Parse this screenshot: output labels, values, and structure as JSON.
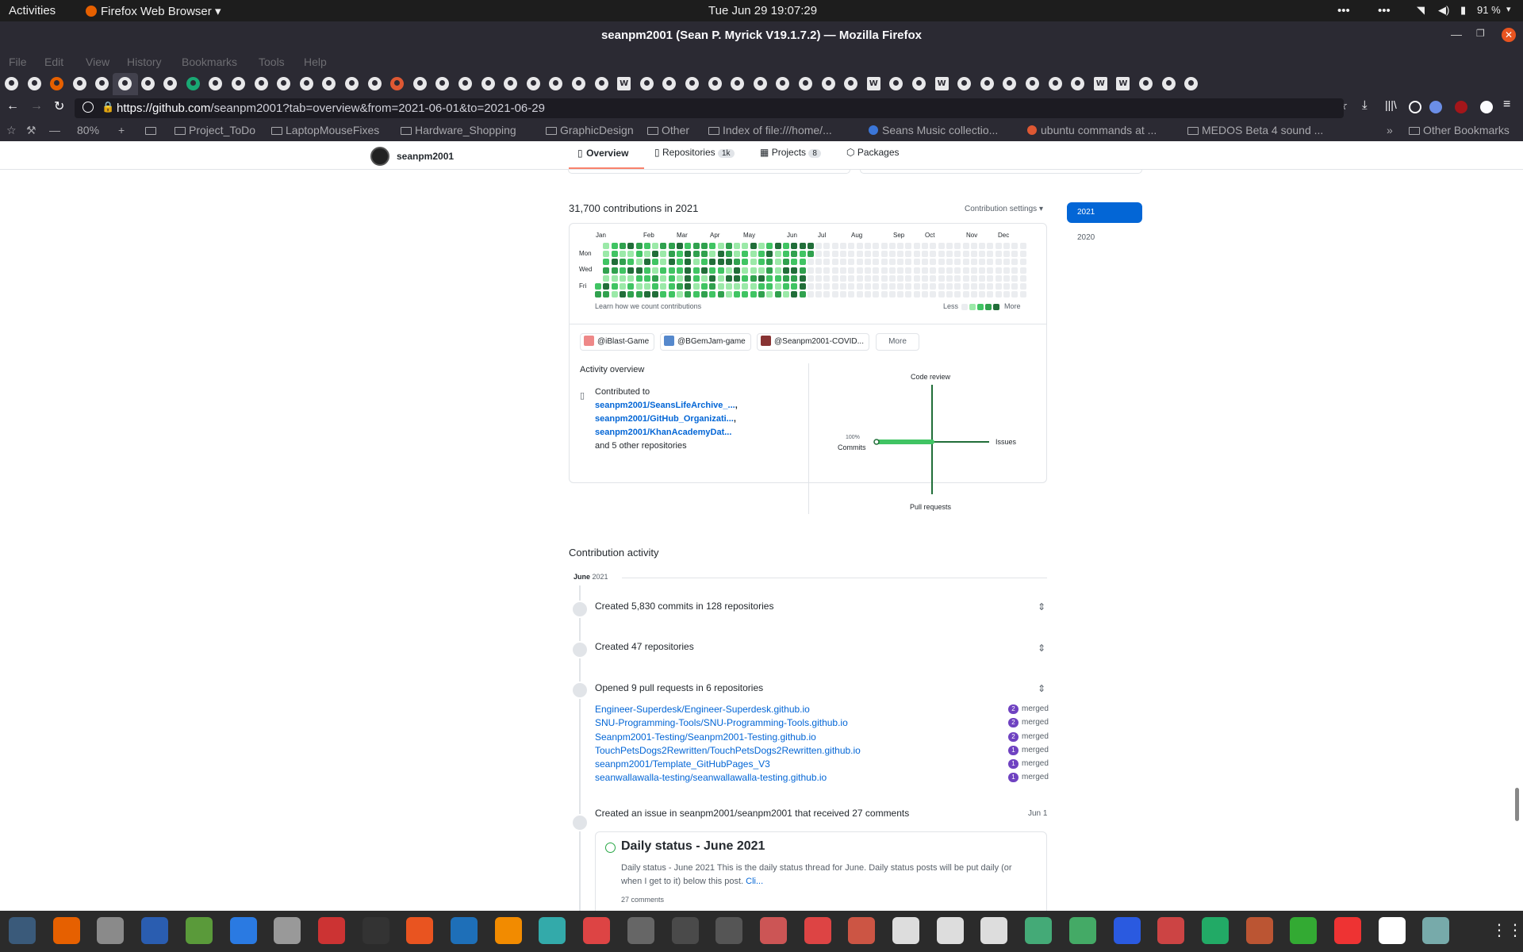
{
  "topbar": {
    "activities": "Activities",
    "app_name": "Firefox Web Browser",
    "clock": "Tue Jun 29  19:07:29",
    "battery": "91 %"
  },
  "window": {
    "title": "seanpm2001 (Sean P. Myrick V19.1.7.2) — Mozilla Firefox"
  },
  "menu": [
    "File",
    "Edit",
    "View",
    "History",
    "Bookmarks",
    "Tools",
    "Help"
  ],
  "navbar": {
    "url_host": "https://github.com",
    "url_path": "/seanpm2001?tab=overview&from=2021-06-01&to=2021-06-29"
  },
  "bookmarks": {
    "zoom": "80%",
    "items": [
      "Project_ToDo",
      "LaptopMouseFixes",
      "Hardware_Shopping",
      "GraphicDesign",
      "Other",
      "Index of file:///home/...",
      "Seans Music collectio...",
      "ubuntu commands at ...",
      "MEDOS Beta 4 sound ..."
    ],
    "other": "Other Bookmarks"
  },
  "profile": {
    "username": "seanpm2001",
    "tabs": [
      {
        "label": "Overview",
        "count": ""
      },
      {
        "label": "Repositories",
        "count": "1k"
      },
      {
        "label": "Projects",
        "count": "8"
      },
      {
        "label": "Packages",
        "count": ""
      }
    ]
  },
  "contrib": {
    "heading": "31,700 contributions in 2021",
    "settings": "Contribution settings",
    "months": [
      "Jan",
      "Feb",
      "Mar",
      "Apr",
      "May",
      "Jun",
      "Jul",
      "Aug",
      "Sep",
      "Oct",
      "Nov",
      "Dec"
    ],
    "days": [
      "Mon",
      "Wed",
      "Fri"
    ],
    "learn": "Learn how we count contributions",
    "less": "Less",
    "more": "More",
    "years": [
      "2021",
      "2020"
    ],
    "colors": {
      "empty": "#ebedf0",
      "l1": "#9be9a8",
      "l2": "#40c463",
      "l3": "#30a14e",
      "l4": "#216e39"
    }
  },
  "orgs": [
    "@iBlast-Game",
    "@BGemJam-game",
    "@Seanpm2001-COVID...",
    "More"
  ],
  "activity": {
    "title": "Activity overview",
    "contributed_to": "Contributed to",
    "repos": [
      "seanpm2001/SeansLifeArchive_...",
      "seanpm2001/GitHub_Organizati...",
      "seanpm2001/KhanAcademyDat..."
    ],
    "others": "and 5 other repositories",
    "axes": {
      "top": "Code review",
      "right": "Issues",
      "bottom": "Pull requests",
      "left_pct": "100%",
      "left": "Commits"
    }
  },
  "timeline": {
    "heading": "Contribution activity",
    "month": "June",
    "year": "2021",
    "commits": "Created 5,830 commits in 128 repositories",
    "repos_created": "Created 47 repositories",
    "prs": "Opened 9 pull requests in 6 repositories",
    "pr_list": [
      {
        "repo": "Engineer-Superdesk/Engineer-Superdesk.github.io",
        "count": "2",
        "state": "merged"
      },
      {
        "repo": "SNU-Programming-Tools/SNU-Programming-Tools.github.io",
        "count": "2",
        "state": "merged"
      },
      {
        "repo": "Seanpm2001-Testing/Seanpm2001-Testing.github.io",
        "count": "2",
        "state": "merged"
      },
      {
        "repo": "TouchPetsDogs2Rewritten/TouchPetsDogs2Rewritten.github.io",
        "count": "1",
        "state": "merged"
      },
      {
        "repo": "seanpm2001/Template_GitHubPages_V3",
        "count": "1",
        "state": "merged"
      },
      {
        "repo": "seanwallawalla-testing/seanwallawalla-testing.github.io",
        "count": "1",
        "state": "merged"
      }
    ],
    "issue_line": "Created an issue in seanpm2001/seanpm2001 that received 27 comments",
    "issue_date": "Jun 1",
    "issue_title": "Daily status - June 2021",
    "issue_body": "Daily status - June 2021 This is the daily status thread for June. Daily status posts will be put daily (or when I get to it) below this post.",
    "issue_more": "Cli...",
    "issue_comments": "27 comments"
  }
}
